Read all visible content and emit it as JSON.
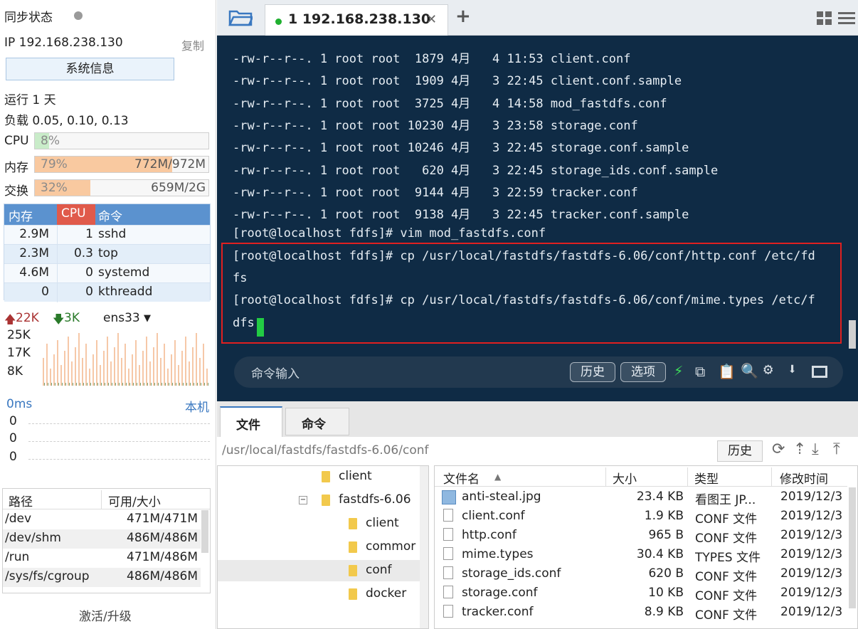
{
  "sidebar": {
    "sync_label": "同步状态",
    "ip": "IP 192.168.238.130",
    "copy": "复制",
    "sysinfo": "系统信息",
    "uptime": "运行 1 天",
    "load": "负载 0.05, 0.10, 0.13",
    "cpu": {
      "label": "CPU",
      "pct": "8%",
      "fraction": 0.08
    },
    "mem": {
      "label": "内存",
      "pct": "79%",
      "val": "772M/972M",
      "fraction": 0.79
    },
    "swap": {
      "label": "交换",
      "pct": "32%",
      "val": "659M/2G",
      "fraction": 0.32
    },
    "proc_headers": [
      "内存",
      "CPU",
      "命令"
    ],
    "procs": [
      {
        "mem": "2.9M",
        "cpu": "1",
        "cmd": "sshd"
      },
      {
        "mem": "2.3M",
        "cpu": "0.3",
        "cmd": "top"
      },
      {
        "mem": "4.6M",
        "cpu": "0",
        "cmd": "systemd"
      },
      {
        "mem": "0",
        "cpu": "0",
        "cmd": "kthreadd"
      }
    ],
    "net": {
      "up": "22K",
      "down": "3K",
      "iface": "ens33",
      "y_ticks": [
        "25K",
        "17K",
        "8K"
      ]
    },
    "ping": {
      "ms": "0ms",
      "host": "本机",
      "vals": [
        "0",
        "0",
        "0"
      ]
    },
    "disk_headers": [
      "路径",
      "可用/大小"
    ],
    "disks": [
      {
        "path": "/dev",
        "size": "471M/471M"
      },
      {
        "path": "/dev/shm",
        "size": "486M/486M"
      },
      {
        "path": "/run",
        "size": "471M/486M"
      },
      {
        "path": "/sys/fs/cgroup",
        "size": "486M/486M"
      }
    ],
    "activate": "激活/升级"
  },
  "tabs": {
    "active": "1 192.168.238.130",
    "add": "+"
  },
  "terminal": {
    "lines": [
      "-rw-r--r--. 1 root root  1879 4月   4 11:53 client.conf",
      "-rw-r--r--. 1 root root  1909 4月   3 22:45 client.conf.sample",
      "-rw-r--r--. 1 root root  3725 4月   4 14:58 mod_fastdfs.conf",
      "-rw-r--r--. 1 root root 10230 4月   3 23:58 storage.conf",
      "-rw-r--r--. 1 root root 10246 4月   3 22:45 storage.conf.sample",
      "-rw-r--r--. 1 root root   620 4月   3 22:45 storage_ids.conf.sample",
      "-rw-r--r--. 1 root root  9144 4月   3 22:59 tracker.conf",
      "-rw-r--r--. 1 root root  9138 4月   3 22:45 tracker.conf.sample",
      "[root@localhost fdfs]# vim mod_fastdfs.conf",
      "[root@localhost fdfs]# cp /usr/local/fastdfs/fastdfs-6.06/conf/http.conf /etc/fd",
      "fs",
      "[root@localhost fdfs]# cp /usr/local/fastdfs/fastdfs-6.06/conf/mime.types /etc/f",
      "dfs"
    ],
    "cmd_placeholder": "命令输入",
    "history": "历史",
    "options": "选项"
  },
  "bottom": {
    "tabs": [
      "文件",
      "命令"
    ],
    "path": "/usr/local/fastdfs/fastdfs-6.06/conf",
    "history": "历史",
    "tree": [
      "client",
      "fastdfs-6.06",
      "client",
      "commor",
      "conf",
      "docker"
    ],
    "file_headers": [
      "文件名",
      "大小",
      "类型",
      "修改时间"
    ],
    "files": [
      {
        "name": "anti-steal.jpg",
        "size": "23.4 KB",
        "type": "看图王 JP...",
        "date": "2019/12/3"
      },
      {
        "name": "client.conf",
        "size": "1.9 KB",
        "type": "CONF 文件",
        "date": "2019/12/3"
      },
      {
        "name": "http.conf",
        "size": "965 B",
        "type": "CONF 文件",
        "date": "2019/12/3"
      },
      {
        "name": "mime.types",
        "size": "30.4 KB",
        "type": "TYPES 文件",
        "date": "2019/12/3"
      },
      {
        "name": "storage_ids.conf",
        "size": "620 B",
        "type": "CONF 文件",
        "date": "2019/12/3"
      },
      {
        "name": "storage.conf",
        "size": "10 KB",
        "type": "CONF 文件",
        "date": "2019/12/3"
      },
      {
        "name": "tracker.conf",
        "size": "8.9 KB",
        "type": "CONF 文件",
        "date": "2019/12/3"
      }
    ]
  }
}
